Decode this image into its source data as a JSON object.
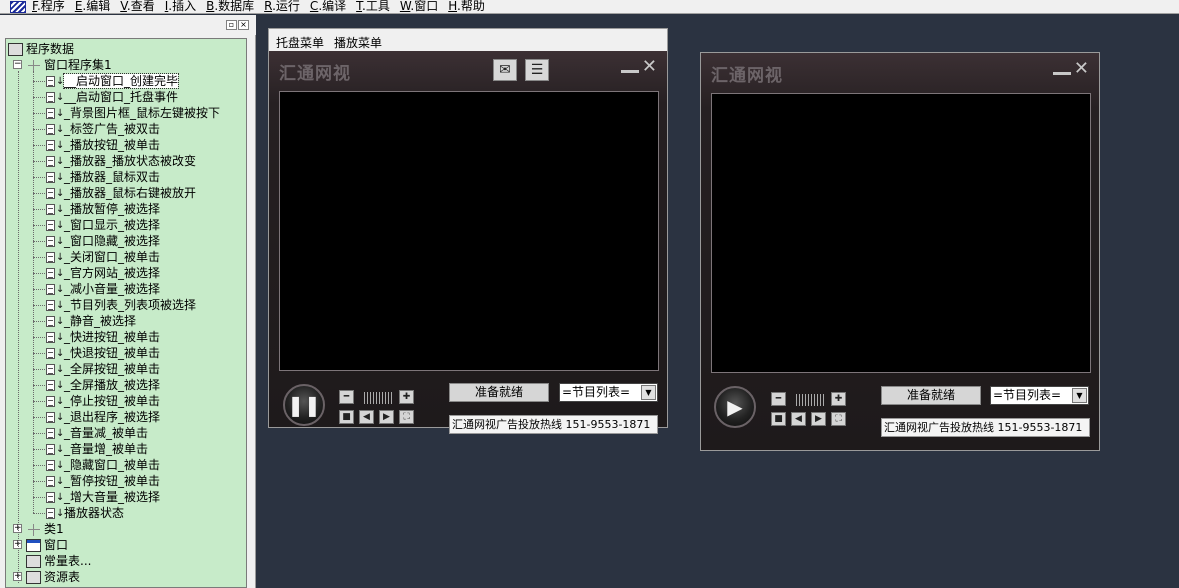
{
  "menubar": {
    "app_icon": "designer-icon",
    "items": [
      {
        "key": "F",
        "label": ".程序"
      },
      {
        "key": "E",
        "label": ".编辑"
      },
      {
        "key": "V",
        "label": ".查看"
      },
      {
        "key": "I",
        "label": ".插入"
      },
      {
        "key": "B",
        "label": ".数据库"
      },
      {
        "key": "R",
        "label": ".运行"
      },
      {
        "key": "C",
        "label": ".编译"
      },
      {
        "key": "T",
        "label": ".工具"
      },
      {
        "key": "W",
        "label": ".窗口"
      },
      {
        "key": "H",
        "label": ".帮助"
      }
    ]
  },
  "panel": {
    "restore_glyph": "▫",
    "close_glyph": "×"
  },
  "tree": {
    "root": "程序数据",
    "module": "窗口程序集1",
    "subs": [
      "__启动窗口_创建完毕",
      "__启动窗口_托盘事件",
      "_背景图片框_鼠标左键被按下",
      "_标签广告_被双击",
      "_播放按钮_被单击",
      "_播放器_播放状态被改变",
      "_播放器_鼠标双击",
      "_播放器_鼠标右键被放开",
      "_播放暂停_被选择",
      "_窗口显示_被选择",
      "_窗口隐藏_被选择",
      "_关闭窗口_被单击",
      "_官方网站_被选择",
      "_减小音量_被选择",
      "_节目列表_列表项被选择",
      "_静音_被选择",
      "_快进按钮_被单击",
      "_快退按钮_被单击",
      "_全屏按钮_被单击",
      "_全屏播放_被选择",
      "_停止按钮_被单击",
      "_退出程序_被选择",
      "_音量减_被单击",
      "_音量增_被单击",
      "_隐藏窗口_被单击",
      "_暂停按钮_被单击",
      "_增大音量_被选择",
      "播放器状态"
    ],
    "tail": [
      {
        "label": "类1",
        "icon": "class-icon",
        "expander": "+"
      },
      {
        "label": "窗口",
        "icon": "window-icon",
        "expander": "+"
      },
      {
        "label": "常量表...",
        "icon": "constant-table-icon",
        "expander": ""
      },
      {
        "label": "资源表",
        "icon": "resource-table-icon",
        "expander": "+"
      }
    ],
    "expander_open": "−"
  },
  "form1": {
    "tray_menu": "托盘菜单",
    "play_menu": "播放菜单",
    "brand": "汇通网视",
    "play_glyph": "❚❚",
    "status": "准备就绪",
    "list": "=节目列表=",
    "hotline": "汇通网视广告投放热线 151-9553-1871",
    "chat_icon": "chat-icon",
    "playlist_icon": "playlist-icon"
  },
  "form2": {
    "brand": "汇通网视",
    "play_glyph": "▶",
    "status": "准备就绪",
    "list": "=节目列表=",
    "hotline": "汇通网视广告投放热线 151-9553-1871"
  },
  "player": {
    "close_glyph": "✕",
    "vol_down": "━",
    "vol_up": "✚",
    "stop": "■",
    "rewind": "◀",
    "forward": "▶",
    "fullscreen": "⛶",
    "dropdown_arrow": "▼"
  },
  "colors": {
    "tree_bg": "#c7ebc9",
    "workspace_bg": "#2b3341",
    "player_skin": "#201a1c"
  }
}
